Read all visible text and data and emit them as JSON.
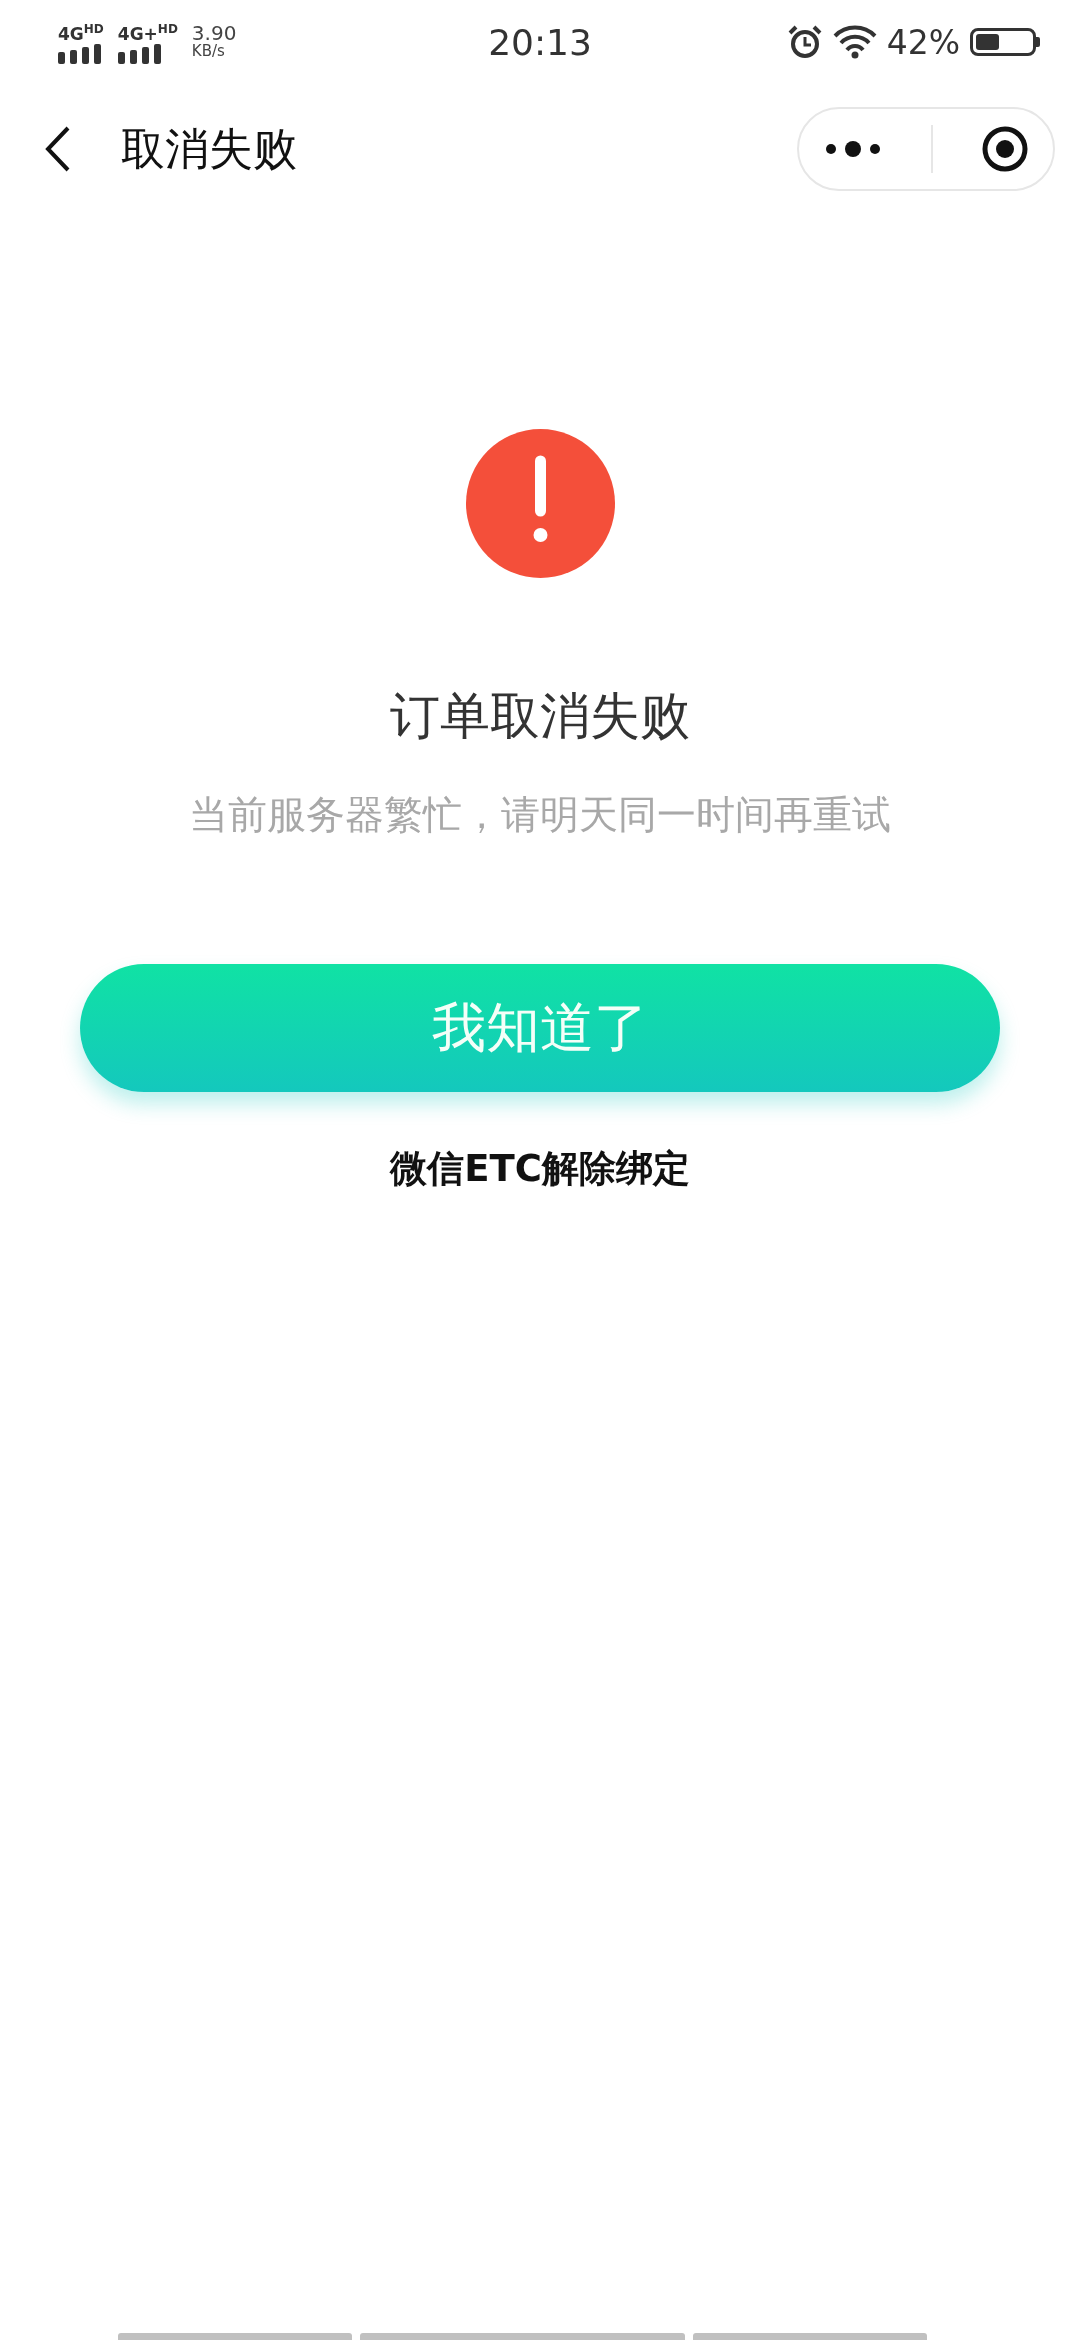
{
  "status_bar": {
    "network_1": "4G",
    "network_1_sup": "HD",
    "network_2": "4G+",
    "network_2_sup": "HD",
    "speed": "3.90",
    "speed_unit": "KB/s",
    "time": "20:13",
    "battery": "42%"
  },
  "nav": {
    "title": "取消失败"
  },
  "result": {
    "kind": "error",
    "title": "订单取消失败",
    "message": "当前服务器繁忙，请明天同一时间再重试"
  },
  "button": {
    "label": "我知道了"
  },
  "link": {
    "label": "微信ETC解除绑定"
  }
}
